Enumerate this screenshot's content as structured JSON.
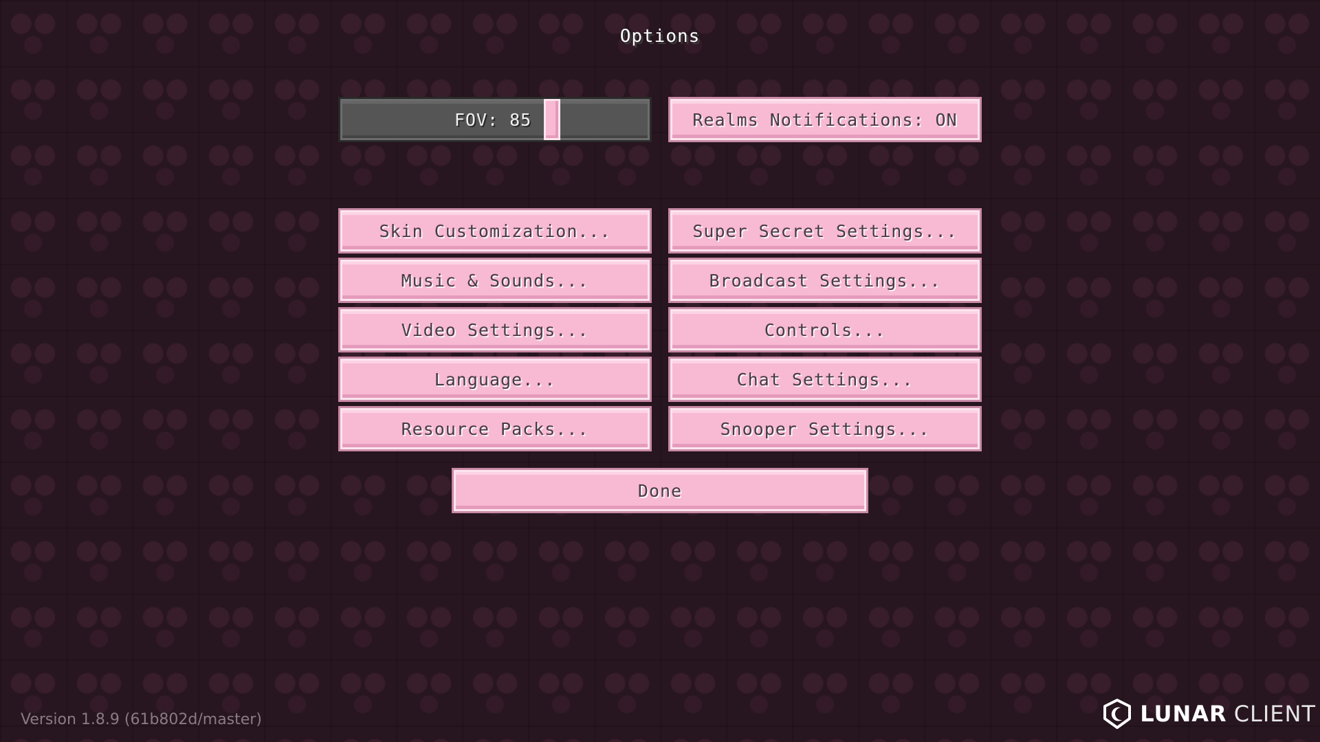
{
  "title": "Options",
  "fov_slider": {
    "label": "FOV: 85",
    "value": 85,
    "min": 30,
    "max": 110
  },
  "realms_notifications": "Realms Notifications: ON",
  "buttons_left": [
    "Skin Customization...",
    "Music & Sounds...",
    "Video Settings...",
    "Language...",
    "Resource Packs..."
  ],
  "buttons_right": [
    "Super Secret Settings...",
    "Broadcast Settings...",
    "Controls...",
    "Chat Settings...",
    "Snooper Settings..."
  ],
  "done_label": "Done",
  "version_text": "Version 1.8.9 (61b802d/master)",
  "brand": {
    "strong": "LUNAR",
    "light": "CLIENT"
  },
  "colors": {
    "button_bg": "#f8b9d3",
    "slider_bg": "#555555",
    "background": "#2f1d27"
  }
}
